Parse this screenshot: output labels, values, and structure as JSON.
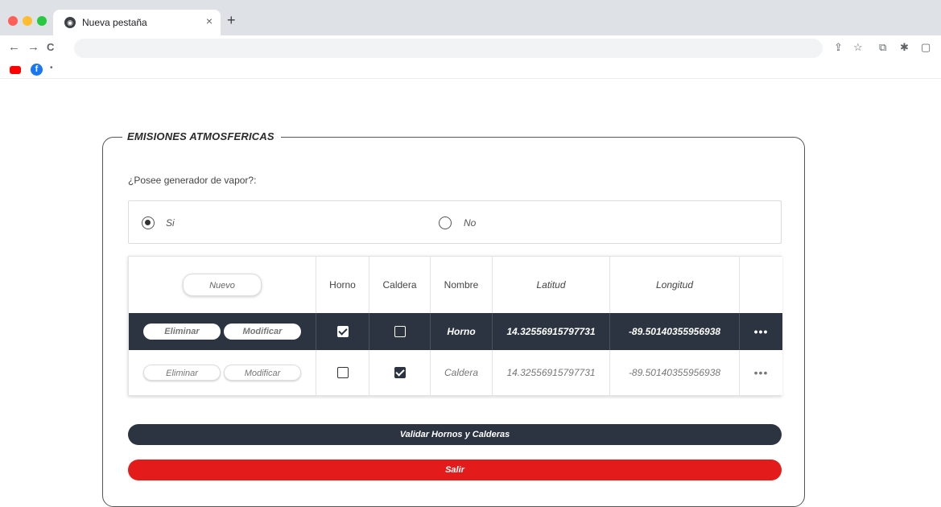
{
  "browser": {
    "tab_title": "Nueva pestaña",
    "tab_close": "×",
    "new_tab": "+",
    "nav": {
      "back": "←",
      "forward": "→",
      "reload": "C"
    },
    "toolbar_icons": [
      "share-icon",
      "star-icon",
      "extension-icon",
      "puzzle-icon",
      "sidebar-icon"
    ],
    "bookmarks": [
      "youtube-icon",
      "facebook-icon"
    ]
  },
  "form": {
    "section_title": "EMISIONES ATMOSFERICAS",
    "question": "¿Posee generador de vapor?:",
    "radio_options": [
      {
        "label": "Si",
        "checked": true
      },
      {
        "label": "No",
        "checked": false
      }
    ],
    "table": {
      "new_button": "Nuevo",
      "headers": [
        "Horno",
        "Caldera",
        "Nombre",
        "Latitud",
        "Longitud"
      ],
      "rows": [
        {
          "delete_label": "Eliminar",
          "edit_label": "Modificar",
          "horno": true,
          "caldera": false,
          "nombre": "Horno",
          "latitud": "14.32556915797731",
          "longitud": "-89.50140355956938",
          "more": "•••"
        },
        {
          "delete_label": "Eliminar",
          "edit_label": "Modificar",
          "horno": false,
          "caldera": true,
          "nombre": "Caldera",
          "latitud": "14.32556915797731",
          "longitud": "-89.50140355956938",
          "more": "•••"
        }
      ]
    },
    "validate_button": "Validar Hornos y Calderas",
    "exit_button": "Salir"
  },
  "colors": {
    "dark": "#2b3440",
    "red": "#e31b1b"
  }
}
